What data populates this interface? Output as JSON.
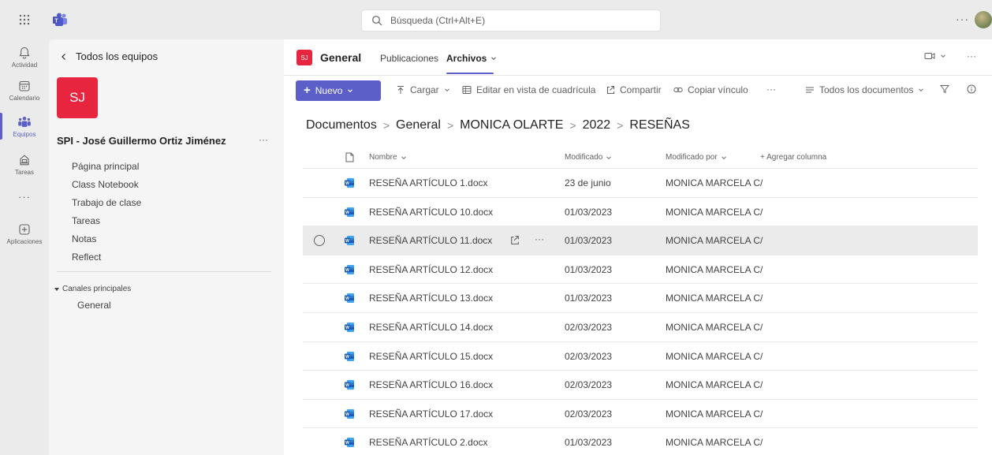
{
  "topbar": {
    "search_placeholder": "Búsqueda (Ctrl+Alt+E)",
    "more": "···"
  },
  "rail": {
    "items": [
      {
        "label": "Actividad",
        "icon": "bell-icon"
      },
      {
        "label": "Calendario",
        "icon": "calendar-icon"
      },
      {
        "label": "Equipos",
        "icon": "teams-icon"
      },
      {
        "label": "Tareas",
        "icon": "assignments-icon"
      },
      {
        "label": "Aplicaciones",
        "icon": "add-apps-icon"
      }
    ],
    "more": "···"
  },
  "team_panel": {
    "back_label": "Todos los equipos",
    "avatar_initials": "SJ",
    "team_name": "SPI - José Guillermo Ortiz Jiménez",
    "more": "···",
    "nav": [
      "Página principal",
      "Class Notebook",
      "Trabajo de clase",
      "Tareas",
      "Notas",
      "Reflect"
    ],
    "channels_header": "Canales principales",
    "channel": "General"
  },
  "channel": {
    "avatar_initials": "SJ",
    "title": "General",
    "tabs": [
      "Publicaciones",
      "Archivos"
    ],
    "more": "···"
  },
  "toolbar": {
    "new_label": "Nuevo",
    "upload_label": "Cargar",
    "grid_label": "Editar en vista de cuadrícula",
    "share_label": "Compartir",
    "copy_link_label": "Copiar vínculo",
    "more": "···",
    "view_label": "Todos los documentos"
  },
  "breadcrumb": [
    "Documentos",
    "General",
    "MONICA OLARTE",
    "2022",
    "RESEÑAS"
  ],
  "table": {
    "headers": {
      "name": "Nombre",
      "modified": "Modificado",
      "modified_by": "Modificado por",
      "add_column": "+ Agregar columna"
    },
    "rows": [
      {
        "name": "RESEÑA ARTÍCULO 1.docx",
        "modified": "23 de junio",
        "modified_by": "MONICA MARCELA C/"
      },
      {
        "name": "RESEÑA ARTÍCULO 10.docx",
        "modified": "01/03/2023",
        "modified_by": "MONICA MARCELA C/"
      },
      {
        "name": "RESEÑA ARTÍCULO 11.docx",
        "modified": "01/03/2023",
        "modified_by": "MONICA MARCELA C/",
        "more": "···"
      },
      {
        "name": "RESEÑA ARTÍCULO 12.docx",
        "modified": "01/03/2023",
        "modified_by": "MONICA MARCELA C/"
      },
      {
        "name": "RESEÑA ARTÍCULO 13.docx",
        "modified": "01/03/2023",
        "modified_by": "MONICA MARCELA C/"
      },
      {
        "name": "RESEÑA ARTÍCULO 14.docx",
        "modified": "02/03/2023",
        "modified_by": "MONICA MARCELA C/"
      },
      {
        "name": "RESEÑA ARTÍCULO 15.docx",
        "modified": "02/03/2023",
        "modified_by": "MONICA MARCELA C/"
      },
      {
        "name": "RESEÑA ARTÍCULO 16.docx",
        "modified": "02/03/2023",
        "modified_by": "MONICA MARCELA C/"
      },
      {
        "name": "RESEÑA ARTÍCULO 17.docx",
        "modified": "02/03/2023",
        "modified_by": "MONICA MARCELA C/"
      },
      {
        "name": "RESEÑA ARTÍCULO 2.docx",
        "modified": "01/03/2023",
        "modified_by": "MONICA MARCELA C/"
      }
    ]
  },
  "colors": {
    "accent": "#5b5fc7",
    "team_avatar": "#e8253f",
    "word_blue": "#185abd"
  }
}
